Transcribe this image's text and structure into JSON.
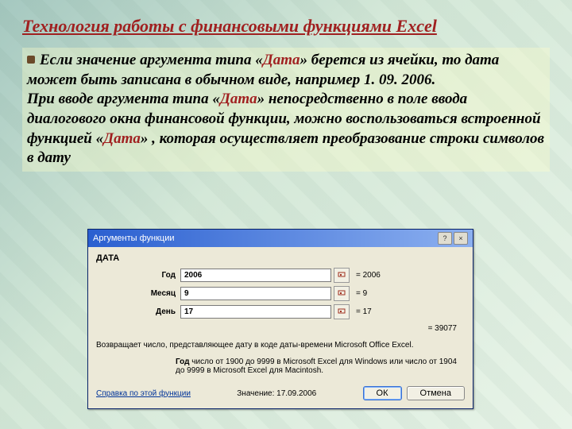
{
  "title": "Технология работы с финансовыми функциями Excel",
  "body": {
    "p1a": "Если значение аргумента типа «",
    "p1b": "Дата",
    "p1c": "» берется из ячейки, то дата может быть записана в обычном виде, например 1. 09. 2006.",
    "p2a": "При вводе аргумента типа «",
    "p2b": "Дата",
    "p2c": "» непосредственно в поле ввода диалогового окна финансовой функции, можно воспользоваться встроенной функцией «",
    "p2d": "Дата",
    "p2e": "» , которая осуществляет преобразование строки символов в дату"
  },
  "dialog": {
    "title": "Аргументы функции",
    "help_icon": "?",
    "close_icon": "×",
    "fn_name": "ДАТА",
    "rows": [
      {
        "label": "Год",
        "value": "2006",
        "eq": "= 2006"
      },
      {
        "label": "Месяц",
        "value": "9",
        "eq": "= 9"
      },
      {
        "label": "День",
        "value": "17",
        "eq": "= 17"
      }
    ],
    "result_preview": "= 39077",
    "description": "Возвращает число, представляющее дату в коде даты-времени Microsoft Office Excel.",
    "arg_desc_label": "Год",
    "arg_desc_text": " число от 1900 до 9999 в Microsoft Excel для Windows или число от 1904 до 9999 в Microsoft Excel для Macintosh.",
    "help_link": "Справка по этой функции",
    "result_label": "Значение:",
    "result_value": "17.09.2006",
    "ok": "ОК",
    "cancel": "Отмена"
  }
}
